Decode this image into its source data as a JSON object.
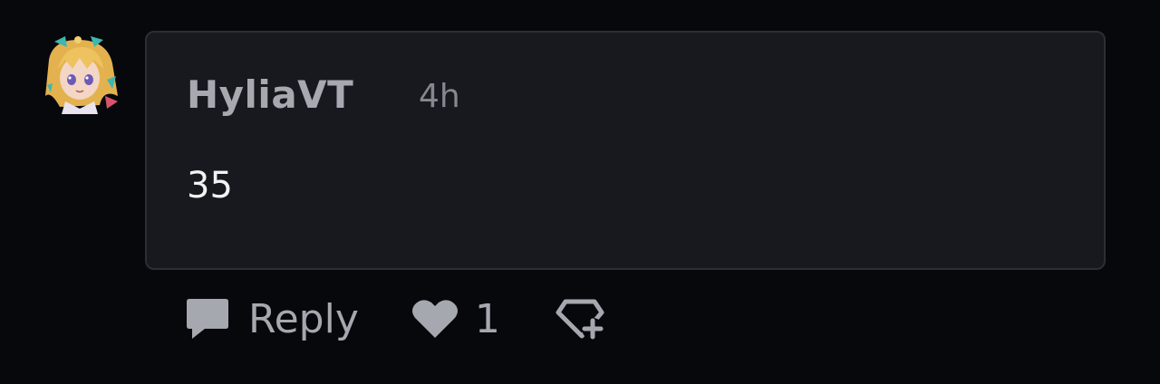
{
  "comment": {
    "username": "HyliaVT",
    "timestamp": "4h",
    "body": "35"
  },
  "actions": {
    "reply_label": "Reply",
    "like_count": "1"
  },
  "icons": {
    "reply": "speech-bubble-icon",
    "like": "heart-icon",
    "award": "gem-plus-icon"
  },
  "colors": {
    "background": "#07080c",
    "card": "#17191e",
    "card_border": "#2b2e35",
    "username": "#a8a8b1",
    "timestamp": "#858791",
    "body_text": "#f2f2f4",
    "action": "#a6a8b0"
  }
}
